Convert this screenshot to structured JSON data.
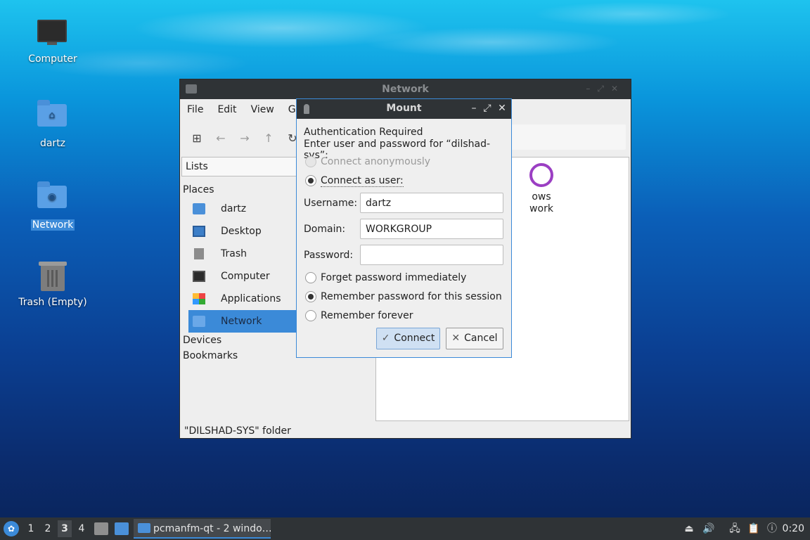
{
  "desktop": {
    "icons": [
      {
        "label": "Computer",
        "icon": "computer-icon"
      },
      {
        "label": "dartz",
        "icon": "home-folder-icon"
      },
      {
        "label": "Network",
        "icon": "network-folder-icon",
        "selected": true
      },
      {
        "label": "Trash (Empty)",
        "icon": "trash-icon"
      }
    ]
  },
  "file_manager": {
    "title": "Network",
    "menu": [
      "File",
      "Edit",
      "View",
      "G"
    ],
    "side_mode": "Lists",
    "places_header": "Places",
    "places": [
      {
        "label": "dartz",
        "icon": "home-folder-icon"
      },
      {
        "label": "Desktop",
        "icon": "desktop-icon"
      },
      {
        "label": "Trash",
        "icon": "trash-icon"
      },
      {
        "label": "Computer",
        "icon": "computer-icon"
      },
      {
        "label": "Applications",
        "icon": "applications-icon"
      },
      {
        "label": "Network",
        "icon": "network-icon",
        "active": true
      }
    ],
    "devices_header": "Devices",
    "bookmarks_header": "Bookmarks",
    "content_item_line1": "ows",
    "content_item_line2": "work",
    "status": "\"DILSHAD-SYS\" folder"
  },
  "mount_dialog": {
    "title": "Mount",
    "auth_required": "Authentication Required",
    "prompt": "Enter user and password for “dilshad-sys”:",
    "connect_anonymously": "Connect anonymously",
    "connect_as_user": "Connect as user:",
    "username_label": "Username:",
    "username_value": "dartz",
    "domain_label": "Domain:",
    "domain_value": "WORKGROUP",
    "password_label": "Password:",
    "password_value": "",
    "forget_password": "Forget password immediately",
    "remember_session": "Remember password for this session",
    "remember_forever": "Remember forever",
    "connect_button": "Connect",
    "cancel_button": "Cancel"
  },
  "taskbar": {
    "workspaces": [
      "1",
      "2",
      "3",
      "4"
    ],
    "active_workspace": "3",
    "task_label": "pcmanfm-qt - 2 windo…",
    "clock": "0:20"
  },
  "colors": {
    "accent": "#3b8ad8",
    "titlebar": "#2f3336",
    "panel": "#2f3336"
  }
}
